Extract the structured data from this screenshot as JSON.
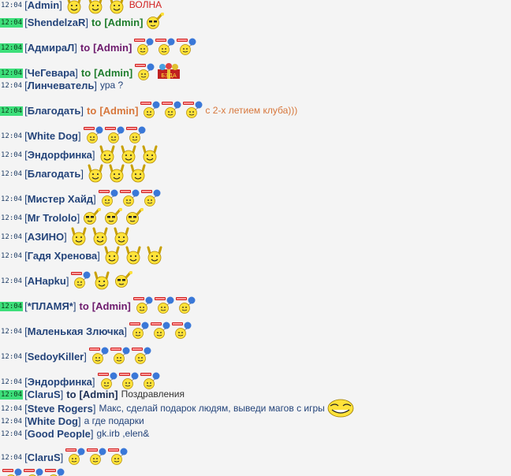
{
  "colors": {
    "nick": "#24447a",
    "to_green": "#1f7d2d",
    "to_purple": "#6d1a6d",
    "to_orange": "#d7773c",
    "msg_default": "#24447a",
    "msg_red": "#d12020",
    "timestamp_highlight": "#3ddf7a"
  },
  "lines": [
    {
      "time": "12:04",
      "hl": false,
      "nick": "Admin",
      "smileys": [
        "rock",
        "rock",
        "rock"
      ],
      "text": "ВОЛНА",
      "text_color": "red"
    },
    {
      "time": "12:04",
      "hl": true,
      "nick": "ShendelzaR",
      "to": "to",
      "target": "Admin",
      "to_color": "green",
      "smileys": [
        "wave"
      ]
    },
    {
      "time": "12:04",
      "hl": true,
      "nick": "АдмираЛ",
      "to": "to",
      "target": "Admin",
      "to_color": "purple",
      "smileys": [
        "balloon",
        "balloon",
        "balloon"
      ]
    },
    {
      "time": "12:04",
      "hl": true,
      "nick": "ЧеГевара",
      "to": "to",
      "target": "Admin",
      "to_color": "green",
      "smileys": [
        "balloon",
        "gift"
      ]
    },
    {
      "time": "12:04",
      "hl": false,
      "nick": "Линчеватель",
      "text": "ура ?",
      "text_color": "default"
    },
    {
      "time": "12:04",
      "hl": true,
      "nick": "Благодать",
      "to": "to",
      "target": "Admin",
      "to_color": "orange",
      "smileys": [
        "balloon",
        "balloon",
        "balloon"
      ],
      "text": "с 2-х летием клуба)))",
      "text_color": "orange"
    },
    {
      "time": "12:04",
      "hl": false,
      "nick": "White Dog",
      "smileys": [
        "balloon",
        "balloon",
        "balloon"
      ]
    },
    {
      "time": "12:04",
      "hl": false,
      "nick": "Эндорфинка",
      "smileys": [
        "rock",
        "rock",
        "rock"
      ]
    },
    {
      "time": "12:04",
      "hl": false,
      "nick": "Благодать",
      "smileys": [
        "rock",
        "rock",
        "rock"
      ]
    },
    {
      "time": "12:04",
      "hl": false,
      "nick": "Мистер Хайд",
      "smileys": [
        "balloon",
        "balloon",
        "balloon"
      ]
    },
    {
      "time": "12:04",
      "hl": false,
      "nick": "Mr Trololo",
      "smileys": [
        "wave",
        "wave",
        "wave"
      ]
    },
    {
      "time": "12:04",
      "hl": false,
      "nick": "АЗИНО",
      "smileys": [
        "rock",
        "rock",
        "rock"
      ]
    },
    {
      "time": "12:04",
      "hl": false,
      "nick": "Гадя Хренова",
      "smileys": [
        "rock",
        "rock",
        "rock"
      ]
    },
    {
      "time": "12:04",
      "hl": false,
      "nick": "AHapku",
      "smileys": [
        "balloon",
        "rock",
        "wave"
      ]
    },
    {
      "time": "12:04",
      "hl": true,
      "nick": "*ПЛАМЯ*",
      "to": "to",
      "target": "Admin",
      "to_color": "purple",
      "smileys": [
        "balloon",
        "balloon",
        "balloon"
      ]
    },
    {
      "time": "12:04",
      "hl": false,
      "nick": "Маленькая Злючка",
      "smileys": [
        "balloon",
        "balloon",
        "balloon"
      ]
    },
    {
      "time": "12:04",
      "hl": false,
      "nick": "SedoyKiller",
      "smileys": [
        "balloon",
        "balloon",
        "balloon"
      ]
    },
    {
      "time": "12:04",
      "hl": false,
      "nick": "Эндорфинка",
      "smileys": [
        "balloon",
        "balloon",
        "balloon"
      ]
    },
    {
      "time": "12:04",
      "hl": true,
      "nick": "ClaruS",
      "to": "to",
      "target": "Admin",
      "to_color": "navy",
      "text": "Поздравления",
      "text_color": "dark"
    },
    {
      "time": "12:04",
      "hl": false,
      "nick": "Steve Rogers",
      "text": "Макс, сделай подарок людям, выведи магов с игры",
      "text_color": "default",
      "smileys_after": [
        "troll"
      ]
    },
    {
      "time": "12:04",
      "hl": false,
      "nick": "White Dog",
      "text": "а где подарки",
      "text_color": "default"
    },
    {
      "time": "12:04",
      "hl": false,
      "nick": "Good People",
      "text": "gk.irb ,elen&",
      "text_color": "default"
    },
    {
      "time": "12:04",
      "hl": false,
      "nick": "ClaruS",
      "smileys": [
        "balloon",
        "balloon",
        "balloon"
      ]
    },
    {
      "time": "",
      "hl": false,
      "nick": "",
      "smileys": [
        "balloon",
        "balloon",
        "balloon"
      ]
    }
  ]
}
